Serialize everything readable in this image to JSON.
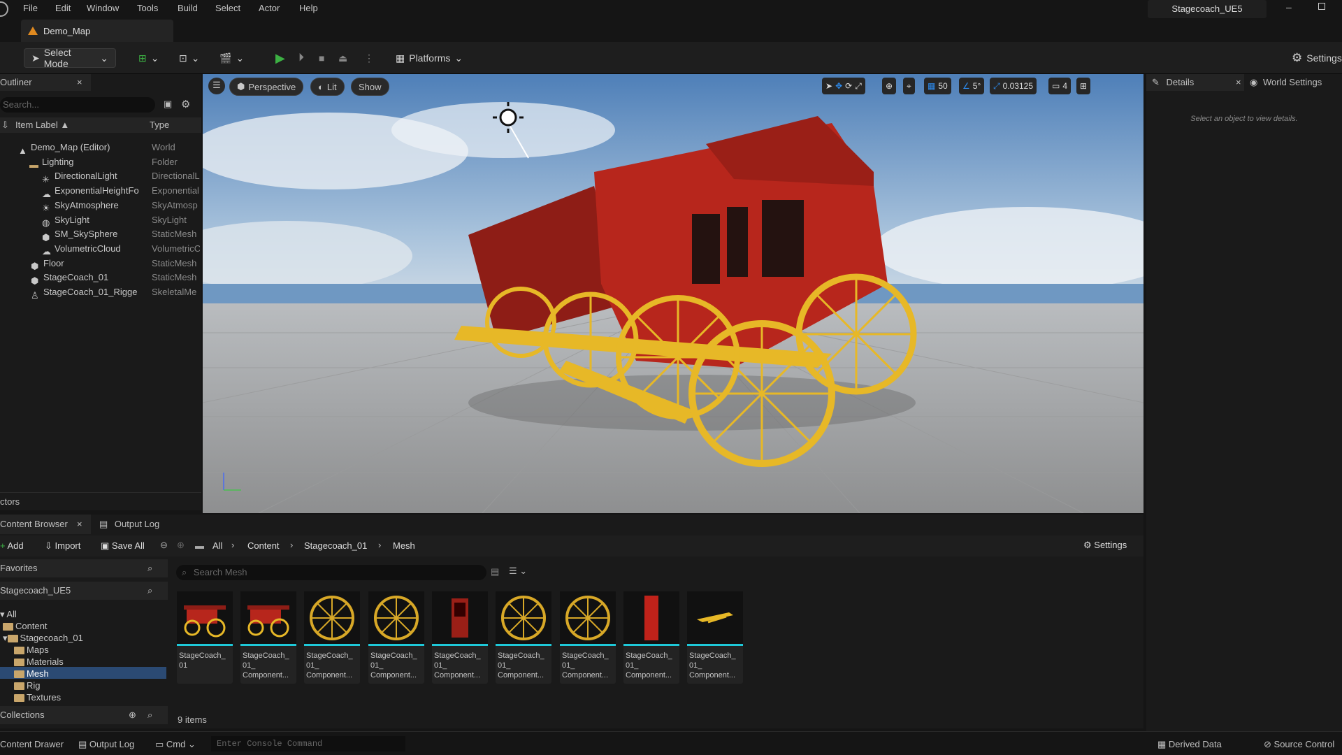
{
  "menu": [
    "File",
    "Edit",
    "Window",
    "Tools",
    "Build",
    "Select",
    "Actor",
    "Help"
  ],
  "project_name": "Stagecoach_UE5",
  "map_tab": "Demo_Map",
  "toolbar": {
    "select_mode": "Select Mode",
    "platforms": "Platforms",
    "settings": "Settings"
  },
  "outliner": {
    "title": "Outliner",
    "search_placeholder": "Search...",
    "col_label": "Item Label",
    "col_type": "Type",
    "rows": [
      {
        "label": "Demo_Map (Editor)",
        "type": "World",
        "icon": "map-icon"
      },
      {
        "label": "Lighting",
        "type": "Folder",
        "icon": "folder-icon"
      },
      {
        "label": "DirectionalLight",
        "type": "DirectionalL",
        "icon": "sun-icon"
      },
      {
        "label": "ExponentialHeightFo",
        "type": "Exponential",
        "icon": "fog-icon"
      },
      {
        "label": "SkyAtmosphere",
        "type": "SkyAtmosp",
        "icon": "sky-icon"
      },
      {
        "label": "SkyLight",
        "type": "SkyLight",
        "icon": "skylight-icon"
      },
      {
        "label": "SM_SkySphere",
        "type": "StaticMesh",
        "icon": "mesh-icon"
      },
      {
        "label": "VolumetricCloud",
        "type": "VolumetricC",
        "icon": "cloud-icon"
      },
      {
        "label": "Floor",
        "type": "StaticMesh",
        "icon": "mesh-icon"
      },
      {
        "label": "StageCoach_01",
        "type": "StaticMesh",
        "icon": "mesh-icon"
      },
      {
        "label": "StageCoach_01_Rigge",
        "type": "SkeletalMe",
        "icon": "skeleton-icon"
      }
    ],
    "footer": "ctors"
  },
  "viewport": {
    "perspective": "Perspective",
    "lit": "Lit",
    "show": "Show",
    "grid": "50",
    "angle": "5°",
    "scale": "0.03125",
    "camera_speed": "4"
  },
  "details": {
    "title": "Details",
    "world_settings": "World Settings",
    "empty": "Select an object to view details."
  },
  "content_browser": {
    "tab": "Content Browser",
    "output_tab": "Output Log",
    "add": "Add",
    "import": "Import",
    "save_all": "Save All",
    "breadcrumb": [
      "All",
      "Content",
      "Stagecoach_01",
      "Mesh"
    ],
    "settings": "Settings",
    "favorites": "Favorites",
    "project": "Stagecoach_UE5",
    "tree": [
      "All",
      "Content",
      "Stagecoach_01",
      "Maps",
      "Materials",
      "Mesh",
      "Rig",
      "Textures"
    ],
    "collections": "Collections",
    "search_placeholder": "Search Mesh",
    "count": "9 items",
    "assets": [
      {
        "line1": "StageCoach_",
        "line2": "01"
      },
      {
        "line1": "StageCoach_",
        "line2": "01_",
        "line3": "Component..."
      },
      {
        "line1": "StageCoach_",
        "line2": "01_",
        "line3": "Component..."
      },
      {
        "line1": "StageCoach_",
        "line2": "01_",
        "line3": "Component..."
      },
      {
        "line1": "StageCoach_",
        "line2": "01_",
        "line3": "Component..."
      },
      {
        "line1": "StageCoach_",
        "line2": "01_",
        "line3": "Component..."
      },
      {
        "line1": "StageCoach_",
        "line2": "01_",
        "line3": "Component..."
      },
      {
        "line1": "StageCoach_",
        "line2": "01_",
        "line3": "Component..."
      },
      {
        "line1": "StageCoach_",
        "line2": "01_",
        "line3": "Component..."
      }
    ]
  },
  "statusbar": {
    "content_drawer": "Content Drawer",
    "output_log": "Output Log",
    "cmd": "Cmd",
    "console_placeholder": "Enter Console Command",
    "derived_data": "Derived Data",
    "source_control": "Source Control"
  },
  "colors": {
    "accent": "#1ec8d8",
    "play": "#3cb043",
    "selection": "#2b4a73"
  }
}
